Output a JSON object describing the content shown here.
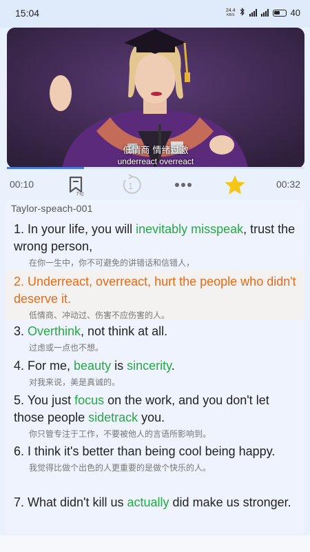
{
  "status_bar": {
    "time": "15:04",
    "net_speed_value": "24.4",
    "net_speed_unit": "KB/S",
    "battery": "40",
    "icons": [
      "bluetooth-icon",
      "signal-icon",
      "signal-icon",
      "battery-icon"
    ]
  },
  "video": {
    "subtitle_zh": "低情商 情绪过激",
    "subtitle_en": "underreact overreact",
    "progress": 0.26
  },
  "controls": {
    "current_time": "00:10",
    "total_time": "00:32",
    "bookmark_count": "7句",
    "loop_count": "1",
    "icons": [
      "bookmark-icon",
      "repeat-one-icon",
      "more-icon",
      "star-icon"
    ],
    "star_color": "#f5c518"
  },
  "playlist": {
    "title": "Taylor-speach-001",
    "highlight_color": "#27a844",
    "active_color": "#e86a16",
    "items": [
      {
        "segments": [
          {
            "text": "1. In your life, you will ",
            "hl": false
          },
          {
            "text": "inevitably misspeak",
            "hl": true
          },
          {
            "text": ", trust the wrong person,",
            "hl": false
          }
        ],
        "zh": "在你一生中，你不可避免的讲错话和信错人，",
        "active": false
      },
      {
        "segments": [
          {
            "text": "2. Underreact, overreact, hurt the people who didn't deserve it.",
            "hl": false
          }
        ],
        "zh": "低情商、冲动过、伤害不应伤害的人。",
        "active": true
      },
      {
        "segments": [
          {
            "text": "3. ",
            "hl": false
          },
          {
            "text": "Overthink",
            "hl": true
          },
          {
            "text": ", not think at all.",
            "hl": false
          }
        ],
        "zh": "过虑或一点也不想。",
        "active": false
      },
      {
        "segments": [
          {
            "text": "4. For me, ",
            "hl": false
          },
          {
            "text": "beauty",
            "hl": true
          },
          {
            "text": " is ",
            "hl": false
          },
          {
            "text": "sincerity",
            "hl": true
          },
          {
            "text": ".",
            "hl": false
          }
        ],
        "zh": "对我来说，美是真诚的。",
        "active": false
      },
      {
        "segments": [
          {
            "text": "5. You just ",
            "hl": false
          },
          {
            "text": "focus",
            "hl": true
          },
          {
            "text": " on the work, and you don't let those people ",
            "hl": false
          },
          {
            "text": "sidetrack",
            "hl": true
          },
          {
            "text": " you.",
            "hl": false
          }
        ],
        "zh": "你只管专注于工作，不要被他人的言语所影响到。",
        "active": false
      },
      {
        "segments": [
          {
            "text": "6. I think it's better than being cool being happy.",
            "hl": false
          }
        ],
        "zh": "我觉得比做个出色的人更重要的是做个快乐的人。",
        "active": false
      },
      {
        "segments": [
          {
            "text": "7. What didn't kill us ",
            "hl": false
          },
          {
            "text": "actually",
            "hl": true
          },
          {
            "text": " did make us stronger.",
            "hl": false
          }
        ],
        "zh": "",
        "active": false
      }
    ]
  }
}
